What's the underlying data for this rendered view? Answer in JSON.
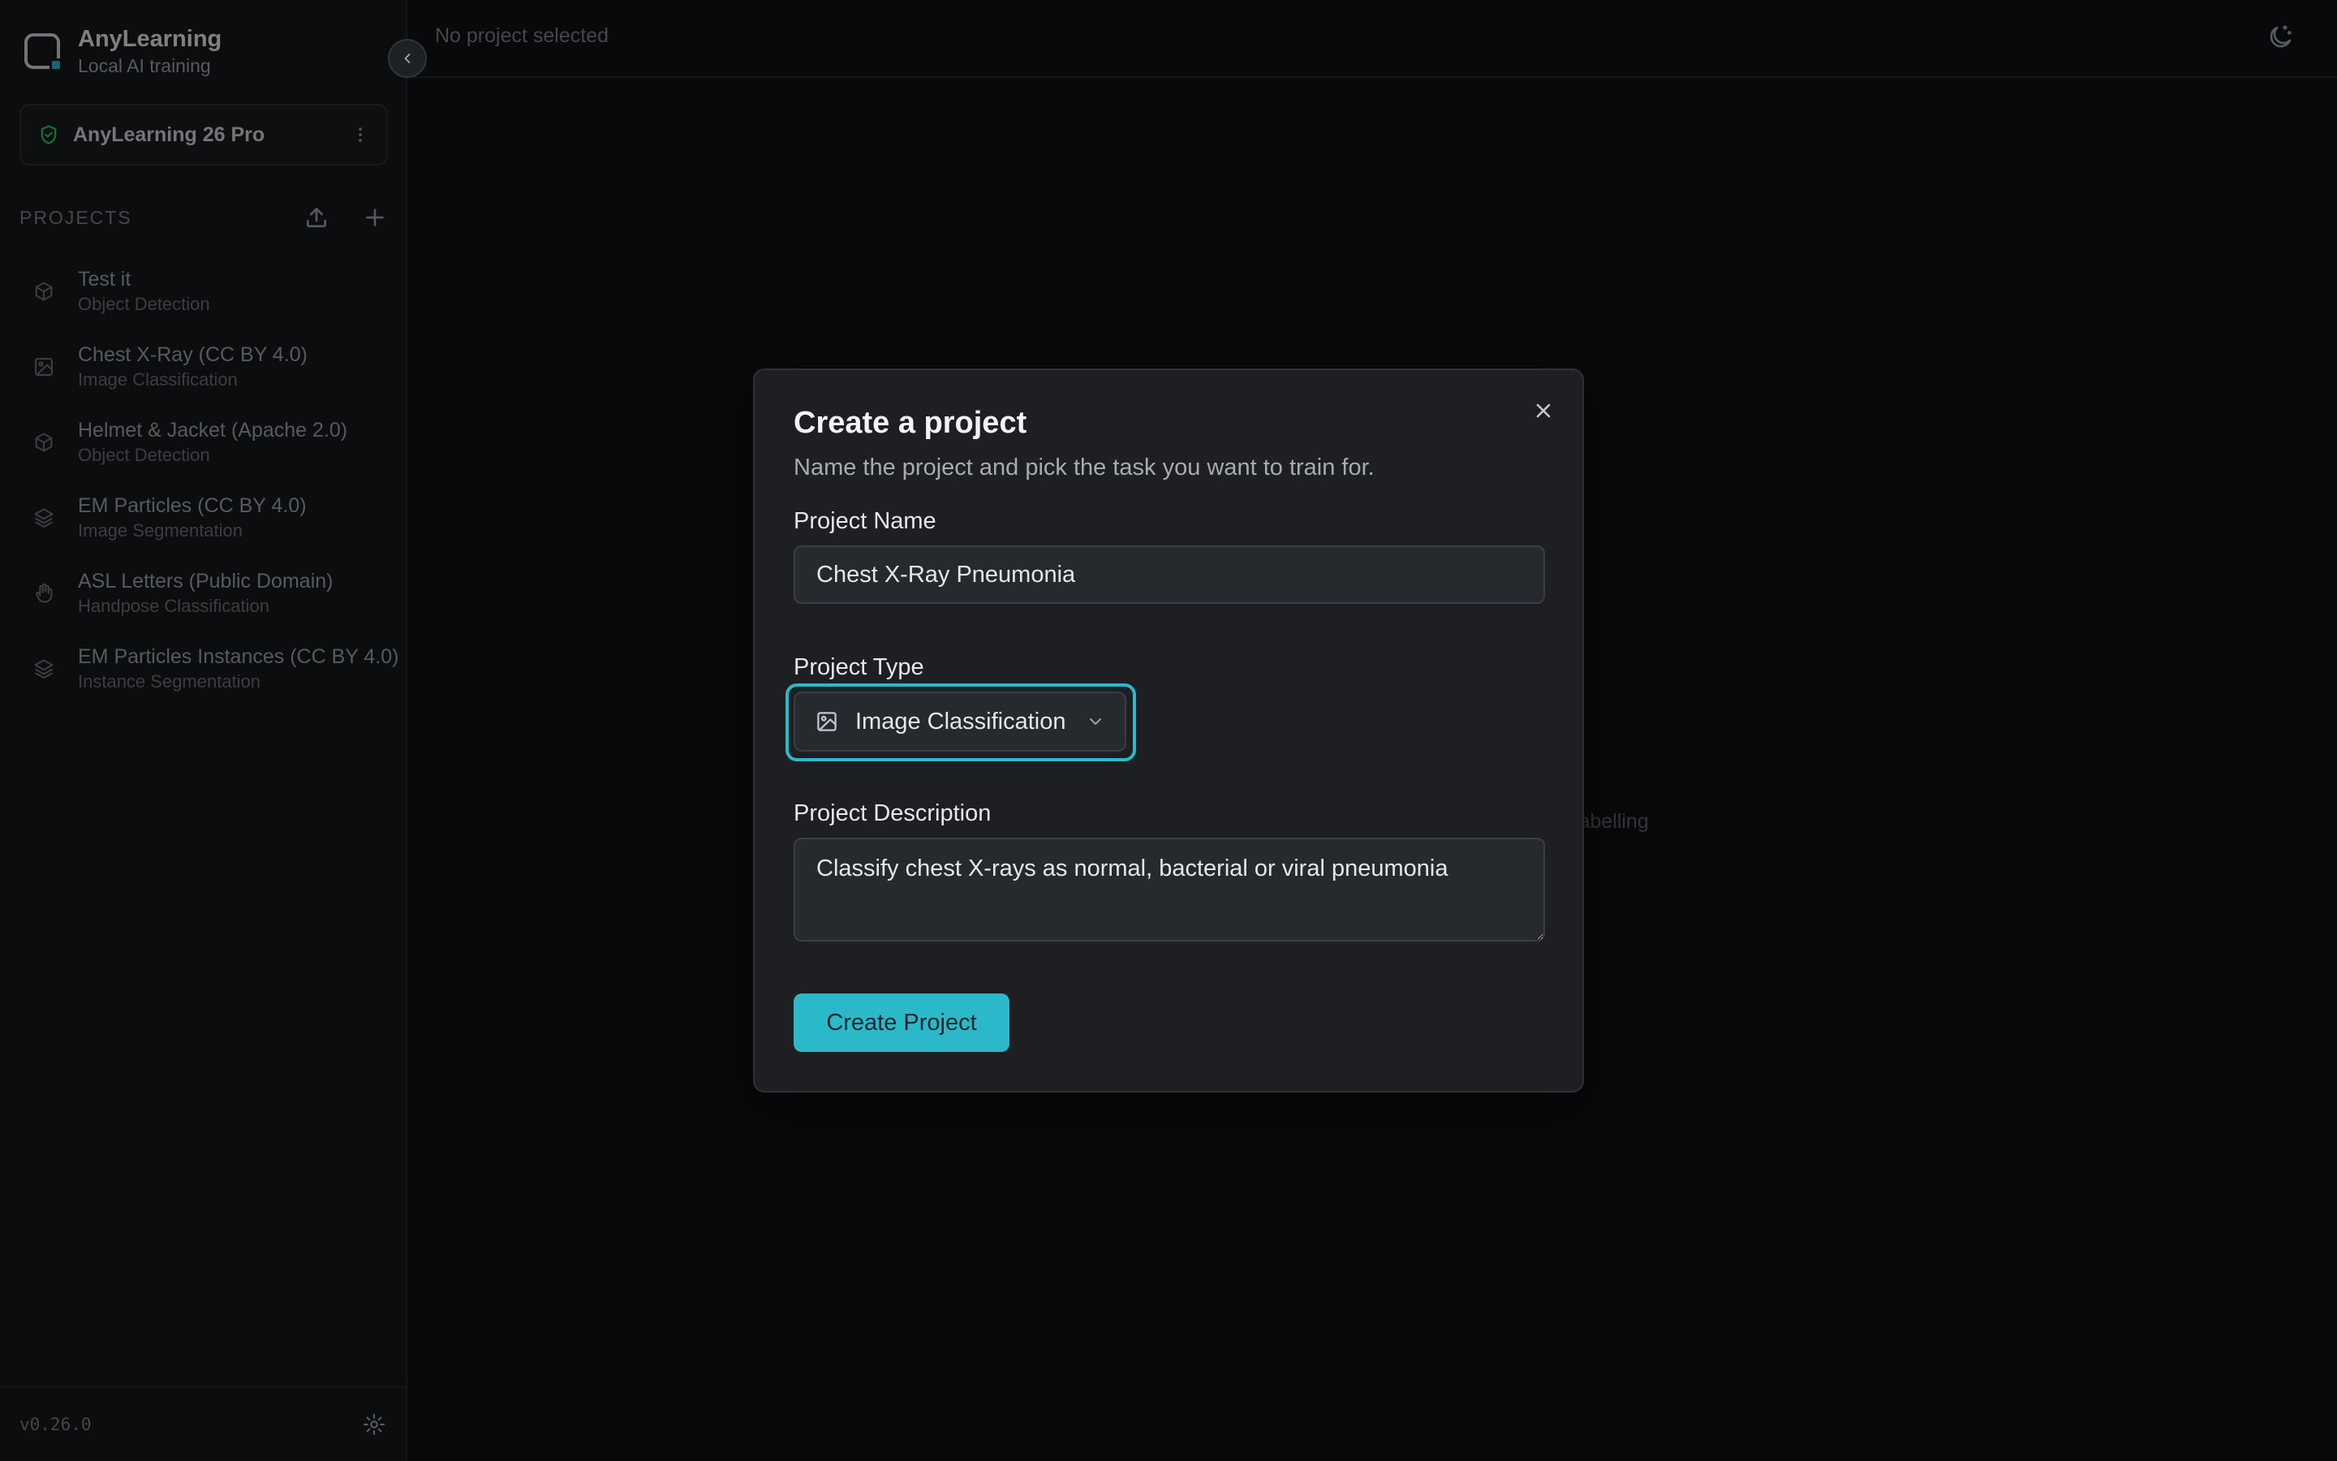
{
  "app": {
    "name": "AnyLearning",
    "tagline": "Local AI training",
    "license_label": "AnyLearning 26 Pro",
    "version": "v0.26.0"
  },
  "sidebar": {
    "section_title": "PROJECTS",
    "projects": [
      {
        "name": "Test it",
        "type": "Object Detection",
        "icon": "cube-icon"
      },
      {
        "name": "Chest X-Ray (CC BY 4.0)",
        "type": "Image Classification",
        "icon": "image-icon"
      },
      {
        "name": "Helmet & Jacket (Apache 2.0)",
        "type": "Object Detection",
        "icon": "cube-icon"
      },
      {
        "name": "EM Particles (CC BY 4.0)",
        "type": "Image Segmentation",
        "icon": "layers-icon"
      },
      {
        "name": "ASL Letters (Public Domain)",
        "type": "Handpose Classification",
        "icon": "hand-icon"
      },
      {
        "name": "EM Particles Instances (CC BY 4.0)",
        "type": "Instance Segmentation",
        "icon": "layers-icon"
      }
    ]
  },
  "topbar": {
    "breadcrumb": "No project selected"
  },
  "background": {
    "hint_text": "labelling"
  },
  "modal": {
    "title": "Create a project",
    "description": "Name the project and pick the task you want to train for.",
    "name_label": "Project Name",
    "name_value": "Chest X-Ray Pneumonia",
    "type_label": "Project Type",
    "type_value": "Image Classification",
    "description_label": "Project Description",
    "description_value": "Classify chest X-rays as normal, bacterial or viral pneumonia",
    "submit_label": "Create Project"
  },
  "colors": {
    "accent": "#2bb8c9",
    "license_ok": "#22c55e"
  }
}
